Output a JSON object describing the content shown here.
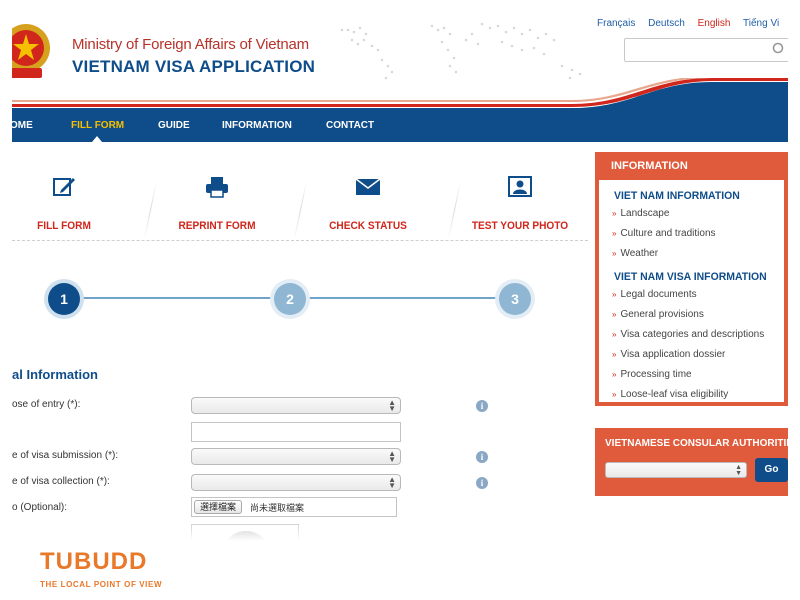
{
  "header": {
    "org_name": "Ministry of Foreign Affairs of Vietnam",
    "app_name": "VIETNAM VISA APPLICATION",
    "languages": [
      "Français",
      "Deutsch",
      "English",
      "Tiếng Vi"
    ],
    "active_language": "English",
    "search": {
      "value": "",
      "placeholder": ""
    }
  },
  "nav": {
    "items": [
      "HOME",
      "FILL FORM",
      "GUIDE",
      "INFORMATION",
      "CONTACT"
    ],
    "visible_items": [
      "HOME",
      "FILL FORM",
      "GUIDE",
      "INFORMATION",
      "CONTACT"
    ],
    "first_item_visible_text": "OME",
    "active": "FILL FORM"
  },
  "actions": [
    {
      "label": "FILL FORM",
      "icon": "edit-icon"
    },
    {
      "label": "REPRINT FORM",
      "icon": "printer-icon"
    },
    {
      "label": "CHECK STATUS",
      "icon": "envelope-icon"
    },
    {
      "label": "TEST YOUR PHOTO",
      "icon": "photo-portrait-icon"
    }
  ],
  "steps": {
    "numbers": [
      "1",
      "2",
      "3"
    ],
    "current": 1
  },
  "form": {
    "section_title": "al Information",
    "fields": [
      {
        "label": "ose of entry (*):",
        "value": ""
      },
      {
        "label": "e of visa submission (*):",
        "value": ""
      },
      {
        "label": "e of visa collection (*):",
        "value": ""
      },
      {
        "label": "o (Optional):",
        "value": ""
      }
    ],
    "file_button": "選擇檔案",
    "file_status": "尚未選取檔案",
    "info_glyph": "i"
  },
  "sidebar": {
    "title": "INFORMATION",
    "sections": [
      {
        "title": "VIET NAM INFORMATION",
        "links": [
          "Landscape",
          "Culture and traditions",
          "Weather"
        ]
      },
      {
        "title": "VIET NAM VISA INFORMATION",
        "links": [
          "Legal documents",
          "General provisions",
          "Visa categories and descriptions",
          "Visa application dossier",
          "Processing time",
          "Loose-leaf visa eligibility"
        ]
      }
    ],
    "bullet": "»",
    "consular": {
      "title": "VIETNAMESE CONSULAR AUTHORITIES",
      "select_value": "",
      "go_label": "Go"
    }
  },
  "watermark": {
    "brand": "TUBUDD",
    "tagline": "THE LOCAL POINT OF VIEW"
  },
  "colors": {
    "brand_blue": "#0f4d8a",
    "brand_red": "#d0261b",
    "panel_orange": "#e05a3c",
    "watermark_orange": "#e8782a"
  }
}
